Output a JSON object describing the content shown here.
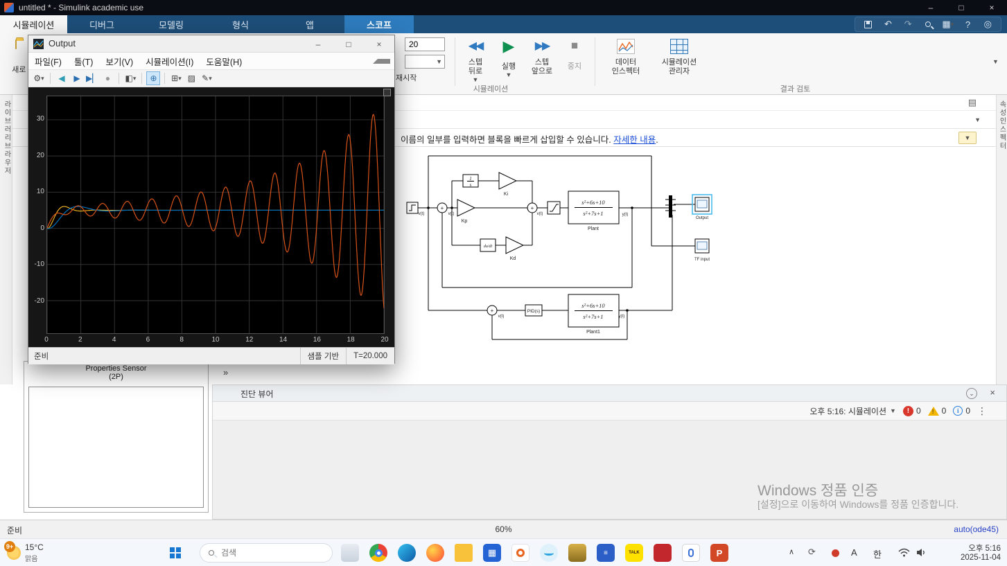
{
  "titlebar": {
    "title": "untitled * - Simulink academic use",
    "min": "–",
    "max": "□",
    "close": "×"
  },
  "tabs": [
    "시뮬레이션",
    "디버그",
    "모델링",
    "형식",
    "앱",
    "스코프"
  ],
  "ribbon": {
    "new_fragment": "새로 드",
    "stop_time": "20",
    "restart": "재시작",
    "step_back": {
      "l1": "스텝",
      "l2": "뒤로"
    },
    "run": "실행",
    "step_forward": {
      "l1": "스텝",
      "l2": "앞으로"
    },
    "stop": "중지",
    "data_inspector": {
      "l1": "데이터",
      "l2": "인스펙터"
    },
    "sim_manager": {
      "l1": "시뮬레이션",
      "l2": "관리자"
    },
    "group_simulation": "시뮬레이션",
    "group_review": "결과 검토"
  },
  "edges": {
    "left_vertical": "라이브러리브라우저",
    "right_vertical": "속성인스펙터"
  },
  "notification": {
    "text": "이름의 일부를 입력하면 블록을 빠르게 삽입할 수 있습니다. ",
    "link": "자세한 내용",
    "suffix": "."
  },
  "collapse_chevron": "»",
  "model": {
    "kp": "Kp",
    "ki": "Ki",
    "kd": "Kd",
    "int_num": "1",
    "int_den": "s",
    "ddt": "du/dt",
    "plant_num": "s²+6s+10",
    "plant_den": "s²+7s+1",
    "plant_label": "Plant",
    "plant1_label": "Plant1",
    "pid": "PID(s)",
    "scope_output": "Output",
    "scope_tfinput": "TF input",
    "vt": "v(t)",
    "yt": "y(t)"
  },
  "props": {
    "title1": "Properties Sensor",
    "title2": "(2P)"
  },
  "diag": {
    "title": "진단 뷰어",
    "session": "오후 5:16: 시뮬레이션",
    "errors": "0",
    "warnings": "0",
    "infos": "0"
  },
  "watermark": {
    "l1": "Windows 정품 인증",
    "l2": "[설정]으로 이동하여 Windows를 정품 인증합니다."
  },
  "status": {
    "ready": "준비",
    "zoom": "60%",
    "solver": "auto(ode45)"
  },
  "taskbar": {
    "weather": {
      "badge": "9+",
      "temp": "15°C",
      "cond": "맑음"
    },
    "search": "검색",
    "kakao_label": "TALK",
    "ppt_label": "P",
    "tray": {
      "ime_a": "A",
      "ime_ko": "한",
      "time": "오후 5:16",
      "date": "2025-11-04"
    }
  },
  "scope": {
    "title": "Output",
    "menu": [
      "파일(F)",
      "툴(T)",
      "보기(V)",
      "시뮬레이션(I)",
      "도움말(H)"
    ],
    "status_left": "준비",
    "status_sample": "샘플 기반",
    "status_time": "T=20.000",
    "chart_data": {
      "type": "line",
      "xlim": [
        0,
        20
      ],
      "ylim": [
        -29,
        36.5
      ],
      "xticks": [
        0,
        2,
        4,
        6,
        8,
        10,
        12,
        14,
        16,
        18,
        20
      ],
      "yticks": [
        30,
        20,
        10,
        0,
        -10,
        -20
      ],
      "grid": true,
      "background": "#000000",
      "signals": [
        {
          "name": "output-fast-yellow",
          "color": "#edb120",
          "K": 5,
          "a": 1.6,
          "b": 3.2,
          "c": 0.6,
          "A": 0,
          "g": 0,
          "w": 0,
          "p": 0,
          "q": 1
        },
        {
          "name": "output-ref-blue",
          "color": "#0072bd",
          "K": 5,
          "a": 0.9,
          "b": 1.8,
          "c": 0.7,
          "A": 0,
          "g": 0,
          "w": 0,
          "p": 0,
          "q": 1
        },
        {
          "name": "output-unstable-orange",
          "color": "#d95319",
          "K": 5,
          "a": 2.5,
          "b": 0,
          "c": 0,
          "A": 1.15,
          "g": 0.162,
          "w": 4.3,
          "p": 0,
          "q": 1
        }
      ]
    }
  }
}
